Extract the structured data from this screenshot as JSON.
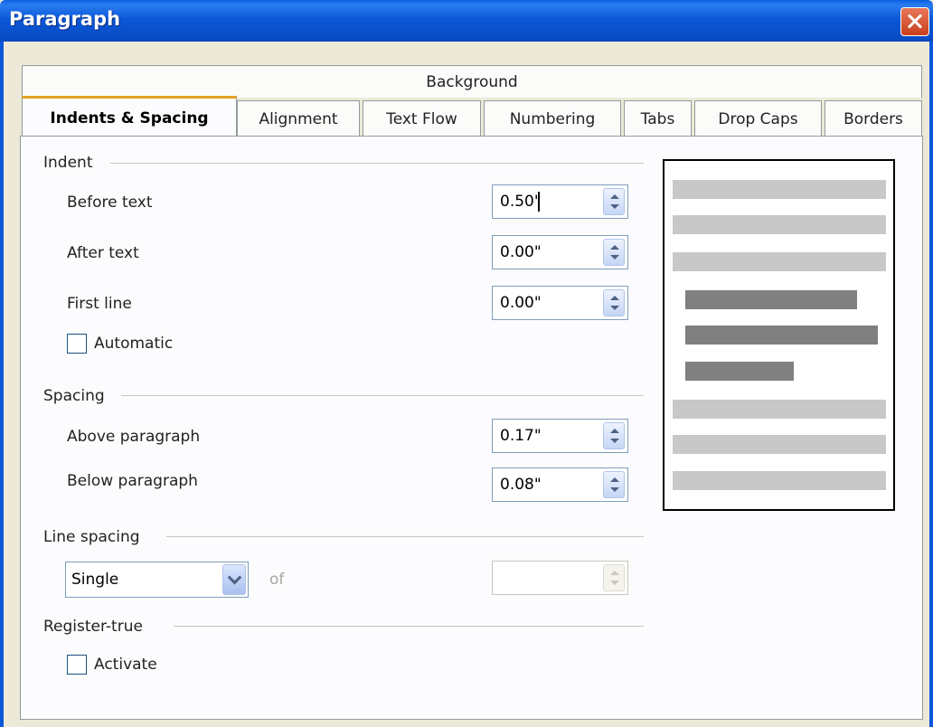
{
  "window": {
    "title": "Paragraph"
  },
  "tabs": {
    "background": "Background",
    "row": [
      {
        "label": "Indents & Spacing",
        "active": true
      },
      {
        "label": "Alignment"
      },
      {
        "label": "Text Flow"
      },
      {
        "label": "Numbering"
      },
      {
        "label": "Tabs"
      },
      {
        "label": "Drop Caps"
      },
      {
        "label": "Borders"
      }
    ]
  },
  "indent": {
    "section_title": "Indent",
    "before_text": {
      "label": "Before text",
      "value": "0.50\""
    },
    "after_text": {
      "label": "After text",
      "value": "0.00\""
    },
    "first_line": {
      "label": "First line",
      "value": "0.00\""
    },
    "automatic": {
      "label": "Automatic",
      "checked": false
    }
  },
  "spacing": {
    "section_title": "Spacing",
    "above_paragraph": {
      "label": "Above paragraph",
      "value": "0.17\""
    },
    "below_paragraph": {
      "label": "Below paragraph",
      "value": "0.08\""
    }
  },
  "line_spacing": {
    "section_title": "Line spacing",
    "selected": "Single",
    "of_label": "of",
    "of_value": ""
  },
  "register_true": {
    "section_title": "Register-true",
    "activate": {
      "label": "Activate",
      "checked": false
    }
  },
  "colors": {
    "titlebar": "#0b58d8",
    "dialog_bg": "#ece9d8",
    "active_tab_accent": "#e6a328",
    "preview_light": "#c8c8c8",
    "preview_dark": "#808080"
  }
}
